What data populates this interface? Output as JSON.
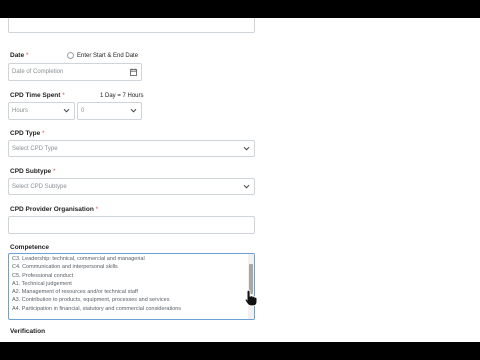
{
  "form": {
    "date": {
      "label": "Date",
      "required": "*",
      "placeholder": "Date of Completion"
    },
    "range_option": {
      "label": "Enter Start & End Date"
    },
    "time": {
      "label": "CPD Time Spent",
      "required": "*",
      "note": "1 Day = 7 Hours",
      "unit_value": "Hours",
      "amount_value": "0"
    },
    "type": {
      "label": "CPD Type",
      "required": "*",
      "placeholder": "Select CPD Type"
    },
    "subtype": {
      "label": "CPD Subtype",
      "required": "*",
      "placeholder": "Select CPD Subtype"
    },
    "provider": {
      "label": "CPD Provider Organisation",
      "required": "*",
      "value": ""
    },
    "competence": {
      "label": "Competence",
      "items": [
        "C3. Leadership: technical, commercial and managerial",
        "C4. Communication and interpersonal skills",
        "C5. Professional conduct",
        "A1. Technical judgement",
        "A2. Management of resources and/or technical staff",
        "A3. Contribution to products, equipment, processes and services",
        "A4. Participation in financial, statutory and commercial considerations"
      ]
    },
    "verification": {
      "label": "Verification"
    }
  },
  "icons": {
    "calendar": "calendar-icon",
    "chevron": "chevron-down-icon",
    "cursor": "hand-cursor-icon"
  },
  "colors": {
    "required": "#d9534f",
    "focus_border": "#6aa1d8"
  }
}
